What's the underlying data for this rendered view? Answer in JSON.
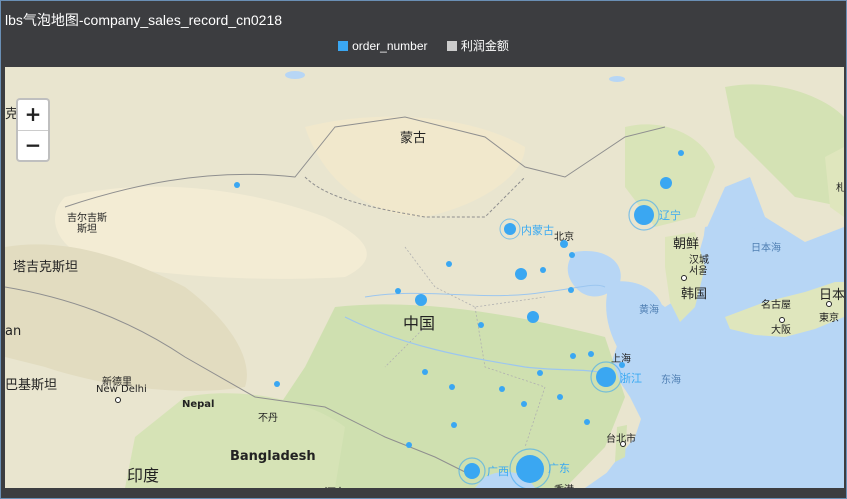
{
  "title": "lbs气泡地图-company_sales_record_cn0218",
  "legend": [
    {
      "label": "order_number",
      "color": "#3aa7f2"
    },
    {
      "label": "利润金额",
      "color": "#cccccc"
    }
  ],
  "zoom": {
    "in": "+",
    "out": "−"
  },
  "colors": {
    "bubble": "#3aa7f2",
    "header": "#3c3d40",
    "land": "#e9e5cf",
    "water": "#b7d6f5"
  },
  "labels": {
    "mongolia": "蒙古",
    "kyrgyzstan_1": "吉尔吉斯",
    "kyrgyzstan_2": "斯坦",
    "tajikistan": "塔吉克斯坦",
    "china": "中国",
    "pakistan": "巴基斯坦",
    "afghan": "an",
    "kazakh_edge": "克",
    "new_delhi_cn": "新德里",
    "new_delhi_en": "New Delhi",
    "nepal": "Nepal",
    "bhutan": "不丹",
    "bangladesh": "Bangladesh",
    "india": "印度",
    "myanmar": "缅甸",
    "korea_north": "朝鲜",
    "seoul_cn": "汉城",
    "seoul_2": "서울",
    "korea": "韩国",
    "japan": "日本",
    "sea_of_japan": "日本海",
    "yellow_sea": "黄海",
    "east_sea": "东海",
    "nagoya": "名古屋",
    "osaka": "大阪",
    "tokyo": "東京",
    "shanghai": "上海",
    "taipei": "台北市",
    "hongkong": "香港",
    "beijing": "北京",
    "edge_right": "札"
  },
  "provinces": {
    "neimenggu": "内蒙古",
    "liaoning": "辽宁",
    "zhejiang": "浙江",
    "guangxi": "广西",
    "guangdong": "广东"
  }
}
